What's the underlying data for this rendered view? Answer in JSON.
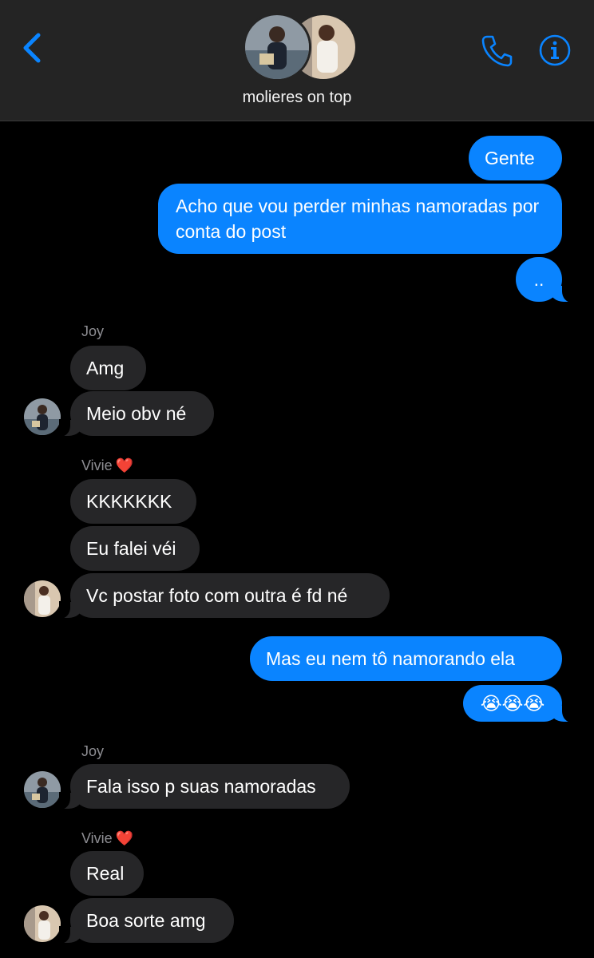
{
  "header": {
    "title": "molieres on top",
    "back_icon": "chevron-left-icon",
    "phone_icon": "phone-icon",
    "info_icon": "info-icon",
    "accent": "#0a84ff",
    "background": "#242424"
  },
  "colors": {
    "outgoing_bubble": "#0a84ff",
    "incoming_bubble": "#262628",
    "background": "#000000",
    "sender_name": "#8e8e93"
  },
  "messages": {
    "m1": "Gente",
    "m2": "Acho que vou perder minhas namoradas por conta do post",
    "m3": "..",
    "joy1": "Joy",
    "m4": "Amg",
    "m5": "Meio obv né",
    "vivie1": "Vivie",
    "m6": "KKKKKKK",
    "m7": "Eu falei véi",
    "m8": "Vc postar foto com outra é fd né",
    "m9": "Mas eu nem tô namorando ela",
    "m10": "😭😭😭",
    "joy2": "Joy",
    "m11": "Fala isso p suas namoradas",
    "vivie2": "Vivie",
    "m12": "Real",
    "m13": "Boa sorte amg"
  },
  "heart": "❤️"
}
